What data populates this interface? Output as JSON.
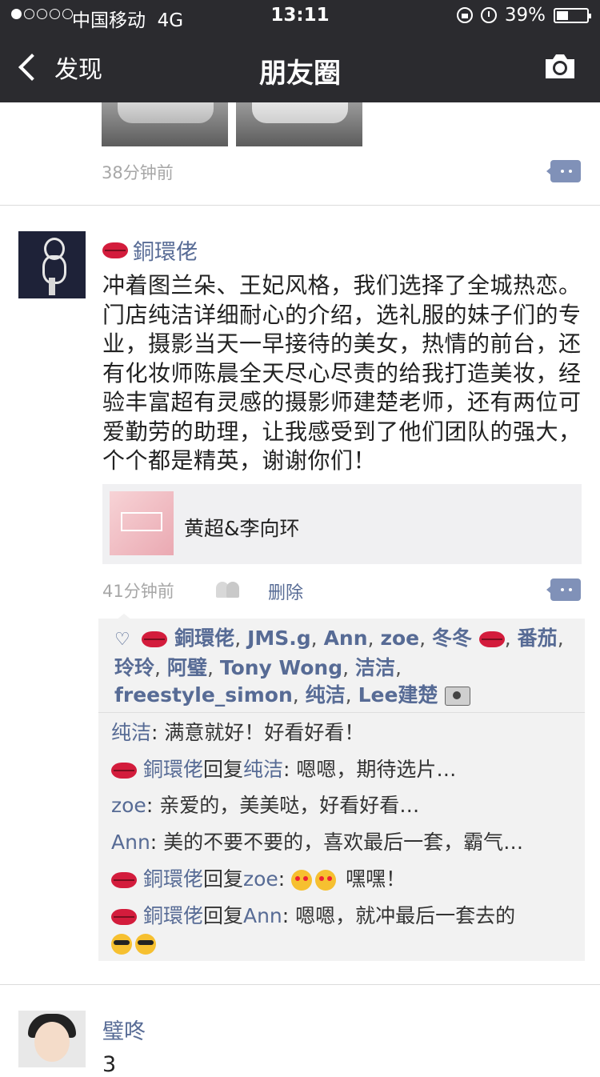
{
  "status_bar": {
    "carrier": "中国移动",
    "network": "4G",
    "time": "13:11",
    "battery": "39%",
    "battery_level": 0.39
  },
  "nav": {
    "back_label": "发现",
    "title": "朋友圈",
    "camera_icon": "camera-icon"
  },
  "prev_post": {
    "time": "38分钟前"
  },
  "post": {
    "author": "銅環佬",
    "text": "冲着图兰朵、王妃风格，我们选择了全城热恋。门店纯洁详细耐心的介绍，选礼服的妹子们的专业，摄影当天一早接待的美女，热情的前台，还有化妆师陈晨全天尽心尽责的给我打造美妆，经验丰富超有灵感的摄影师建楚老师，还有两位可爱勤劳的助理，让我感受到了他们团队的强大，个个都是精英，谢谢你们！",
    "link_title": "黄超&李向环",
    "time": "41分钟前",
    "delete_label": "删除",
    "likes": [
      "銅環佬",
      "JMS.g",
      "Ann",
      "zoe",
      "冬冬",
      "番茄",
      "玲玲",
      "阿璧",
      "Tony Wong",
      "洁洁",
      "freestyle_simon",
      "纯洁",
      "Lee建楚"
    ],
    "comments": [
      {
        "from": "纯洁",
        "text": "满意就好！好看好看！"
      },
      {
        "from": "銅環佬",
        "reply_word": "回复",
        "to": "纯洁",
        "text": "嗯嗯，期待选片…"
      },
      {
        "from": "zoe",
        "text": "亲爱的，美美哒，好看好看…"
      },
      {
        "from": "Ann",
        "text": "美的不要不要的，喜欢最后一套，霸气…"
      },
      {
        "from": "銅環佬",
        "reply_word": "回复",
        "to": "zoe",
        "text": "嘿嘿！"
      },
      {
        "from": "銅環佬",
        "reply_word": "回复",
        "to": "Ann",
        "text": "嗯嗯，就冲最后一套去的"
      }
    ]
  },
  "next_post": {
    "author": "璧咚",
    "text": "3"
  },
  "colors": {
    "nav_bg": "#2b2b2f",
    "name_link": "#576b95",
    "time_gray": "#a7a7a7",
    "comment_bg": "#f2f2f2"
  }
}
